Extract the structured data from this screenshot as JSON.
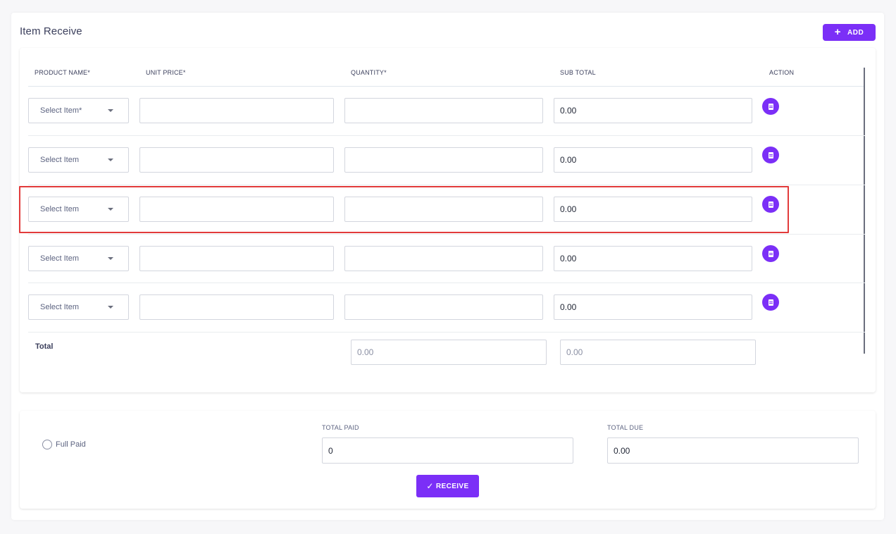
{
  "page": {
    "title": "Item Receive",
    "add_label": "ADD",
    "add_icon": "plus-icon"
  },
  "table": {
    "headers": {
      "product_name": "PRODUCT NAME*",
      "unit_price": "UNIT PRICE*",
      "quantity": "QUANTITY*",
      "sub_total": "SUB TOTAL",
      "action": "ACTION"
    },
    "rows": [
      {
        "product": "Select Item*",
        "unit_price": "",
        "quantity": "",
        "sub_total": "0.00"
      },
      {
        "product": "Select Item",
        "unit_price": "",
        "quantity": "",
        "sub_total": "0.00"
      },
      {
        "product": "Select Item",
        "unit_price": "",
        "quantity": "",
        "sub_total": "0.00"
      },
      {
        "product": "Select Item",
        "unit_price": "",
        "quantity": "",
        "sub_total": "0.00"
      },
      {
        "product": "Select Item",
        "unit_price": "",
        "quantity": "",
        "sub_total": "0.00"
      }
    ],
    "highlighted_row": 3,
    "total": {
      "label": "Total",
      "quantity_total": "0.00",
      "sub_total": "0.00"
    }
  },
  "payment": {
    "full_paid_label": "Full Paid",
    "total_paid_label": "TOTAL PAID",
    "total_paid_value": "0",
    "total_due_label": "TOTAL DUE",
    "total_due_value": "0.00",
    "receive_label": "RECEIVE"
  },
  "colors": {
    "accent": "#7b2ff7",
    "highlight": "#e23b3b",
    "text": "#3b3f5c"
  }
}
